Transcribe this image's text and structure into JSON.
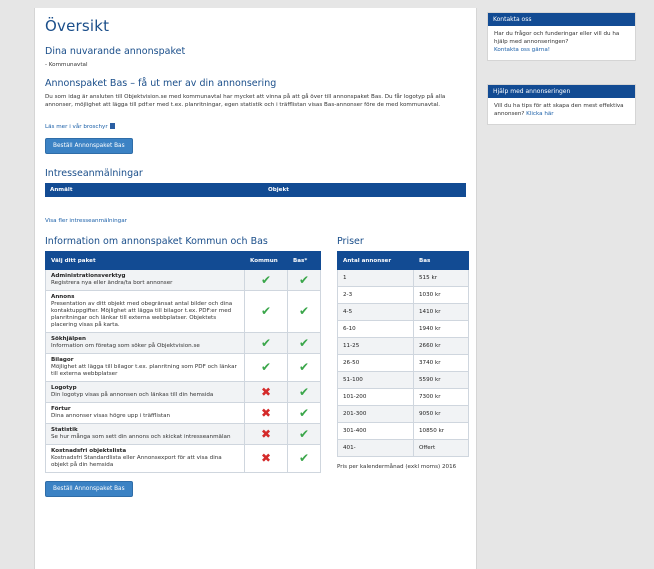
{
  "page_title": "Översikt",
  "current_packages": {
    "heading": "Dina nuvarande annonspaket",
    "item": "- Kommunavtal"
  },
  "bas": {
    "heading": "Annonspaket Bas – få ut mer av din annonsering",
    "text": "Du som idag är ansluten till Objektvision.se med kommunavtal har mycket att vinna på att gå över till annonspaket Bas. Du får logotyp på alla annonser, möjlighet att lägga till pdf:er med t.ex. planritningar, egen statistik och i träfflistan visas Bas-annonser före de med kommunavtal.",
    "brochure_link": "Läs mer i vår broschyr",
    "order_button": "Beställ Annonspaket Bas"
  },
  "interest": {
    "heading": "Intresseanmälningar",
    "col_reported": "Anmält",
    "col_object": "Objekt",
    "more_link": "Visa fler intresseanmälningar"
  },
  "info": {
    "heading": "Information om annonspaket Kommun och Bas",
    "col_package": "Välj ditt paket",
    "col_kommun": "Kommun",
    "col_bas": "Bas*",
    "rows": [
      {
        "name": "Administrationsverktyg",
        "desc": "Registrera nya eller ändra/ta bort annonser",
        "kommun": "check",
        "bas": "check"
      },
      {
        "name": "Annons",
        "desc": "Presentation av ditt objekt med obegränsat antal bilder och dina kontaktuppgifter. Möjlighet att lägga till bilagor t.ex. PDF:er med planritningar och länkar till externa webbplatser. Objektets placering visas på karta.",
        "kommun": "check",
        "bas": "check"
      },
      {
        "name": "Sökhjälpen",
        "desc": "Information om företag som söker på Objektvision.se",
        "kommun": "check",
        "bas": "check"
      },
      {
        "name": "Bilagor",
        "desc": "Möjlighet att lägga till bilagor t.ex. planritning som PDF och länkar till externa webbplatser",
        "kommun": "check",
        "bas": "check"
      },
      {
        "name": "Logotyp",
        "desc": "Din logotyp visas på annonsen och länkas till din hemsida",
        "kommun": "cross",
        "bas": "check"
      },
      {
        "name": "Förtur",
        "desc": "Dina annonser visas högre upp i träfflistan",
        "kommun": "cross",
        "bas": "check"
      },
      {
        "name": "Statistik",
        "desc": "Se hur många som sett din annons och skickat intresseanmälan",
        "kommun": "cross",
        "bas": "check"
      },
      {
        "name": "Kostnadsfri objektslista",
        "desc": "Kostnadsfri Standardlista eller Annonsexport för att visa dina objekt på din hemsida",
        "kommun": "cross",
        "bas": "check"
      }
    ],
    "order_button": "Beställ Annonspaket Bas"
  },
  "prices": {
    "heading": "Priser",
    "col_count": "Antal annonser",
    "col_bas": "Bas",
    "rows": [
      {
        "count": "1",
        "price": "515 kr"
      },
      {
        "count": "2-3",
        "price": "1030 kr"
      },
      {
        "count": "4-5",
        "price": "1410 kr"
      },
      {
        "count": "6-10",
        "price": "1940 kr"
      },
      {
        "count": "11-25",
        "price": "2660 kr"
      },
      {
        "count": "26-50",
        "price": "3740 kr"
      },
      {
        "count": "51-100",
        "price": "5590 kr"
      },
      {
        "count": "101-200",
        "price": "7300 kr"
      },
      {
        "count": "201-300",
        "price": "9050 kr"
      },
      {
        "count": "301-400",
        "price": "10850 kr"
      },
      {
        "count": "401-",
        "price": "Offert"
      }
    ],
    "note": "Pris per kalendermånad (exkl moms) 2016"
  },
  "sidebar": {
    "contact": {
      "heading": "Kontakta oss",
      "text": "Har du frågor och funderingar eller vill du ha hjälp med annonseringen?",
      "link": "Kontakta oss gärna!"
    },
    "help": {
      "heading": "Hjälp med annonseringen",
      "text": "Vill du ha tips för att skapa den mest effektiva annonsen?",
      "link": "Klicka här"
    }
  },
  "icons": {
    "check": "✔",
    "cross": "✖"
  },
  "colors": {
    "primary": "#124b93",
    "heading": "#1a4e8a",
    "check": "#3aa64a",
    "cross": "#d42a2a",
    "button": "#3b82c4"
  }
}
